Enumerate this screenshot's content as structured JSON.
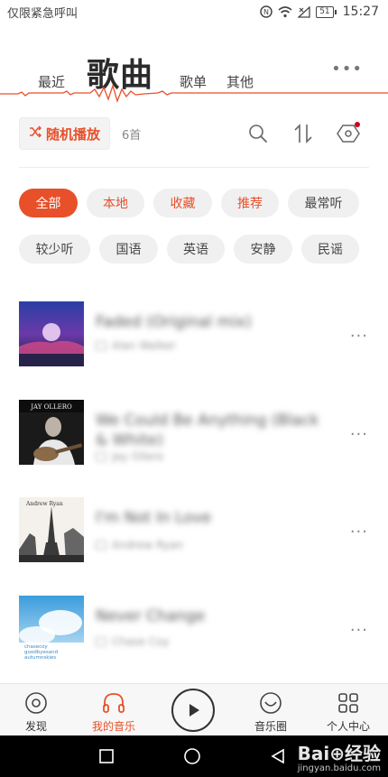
{
  "status_bar": {
    "carrier": "仅限紧急呼叫",
    "battery": "51",
    "time": "15:27"
  },
  "tabs": [
    {
      "label": "最近"
    },
    {
      "label": "歌曲"
    },
    {
      "label": "歌单"
    },
    {
      "label": "其他"
    }
  ],
  "actions": {
    "shuffle_label": "随机播放",
    "count": "6首"
  },
  "chips": [
    {
      "label": "全部"
    },
    {
      "label": "本地"
    },
    {
      "label": "收藏"
    },
    {
      "label": "推荐"
    },
    {
      "label": "最常听"
    },
    {
      "label": "较少听"
    },
    {
      "label": "国语"
    },
    {
      "label": "英语"
    },
    {
      "label": "安静"
    },
    {
      "label": "民谣"
    }
  ],
  "songs": [
    {
      "title": "Faded (Original mix)",
      "artist": "Alan Walker"
    },
    {
      "title": "We Could Be Anything (Black & White)",
      "artist": "Jay Ollero"
    },
    {
      "title": "I'm Not In Love",
      "artist": "Andrew Ryan"
    },
    {
      "title": "Never Change",
      "artist": "Chase Coy"
    }
  ],
  "bottom_nav": [
    {
      "label": "发现"
    },
    {
      "label": "我的音乐"
    },
    {
      "label": "音乐圈"
    },
    {
      "label": "个人中心"
    }
  ],
  "watermark": {
    "main": "Bai⊕经验",
    "sub": "jingyan.baidu.com"
  },
  "colors": {
    "accent": "#e8502a",
    "text": "#333333",
    "chip_bg": "#f0f0f0"
  }
}
